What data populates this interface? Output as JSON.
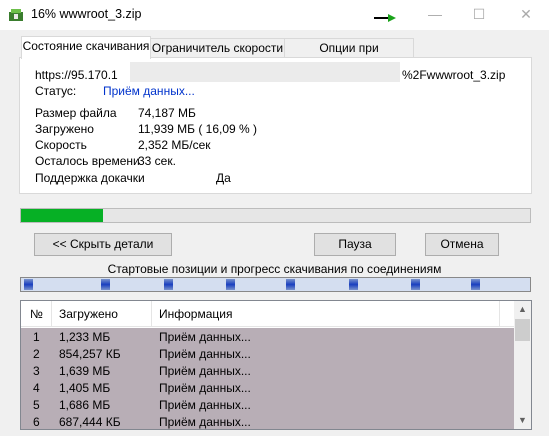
{
  "window": {
    "title": "16% wwwroot_3.zip",
    "minimize": "—",
    "maximize": "☐",
    "close": "✕"
  },
  "tabs": [
    "Состояние скачивания",
    "Ограничитель скорости",
    "Опции при завершении"
  ],
  "download": {
    "url_start": "https://95.170.1",
    "url_end": "%2Fwwwroot_3.zip",
    "status_label": "Статус:",
    "status_value": "Приём данных...",
    "file_size_label": "Размер файла",
    "file_size_value": "74,187  МБ",
    "downloaded_label": "Загружено",
    "downloaded_value": "11,939  МБ  ( 16,09 % )",
    "speed_label": "Скорость",
    "speed_value": "2,352  МБ/сек",
    "remaining_label": "Осталось времени",
    "remaining_value": "33 сек.",
    "resume_label": "Поддержка докачки",
    "resume_value": "Да",
    "progress_fraction": 0.1609
  },
  "buttons": {
    "hide_details": "<< Скрыть детали",
    "pause": "Пауза",
    "cancel": "Отмена"
  },
  "connections_caption": "Стартовые позиции и прогресс скачивания по соединениям",
  "table": {
    "columns": [
      "№",
      "Загружено",
      "Информация"
    ],
    "rows": [
      [
        "1",
        "1,233  МБ",
        "Приём данных..."
      ],
      [
        "2",
        "854,257  КБ",
        "Приём данных..."
      ],
      [
        "3",
        "1,639  МБ",
        "Приём данных..."
      ],
      [
        "4",
        "1,405  МБ",
        "Приём данных..."
      ],
      [
        "5",
        "1,686  МБ",
        "Приём данных..."
      ],
      [
        "6",
        "687,444  КБ",
        "Приём данных..."
      ]
    ]
  },
  "colors": {
    "progress": "#06b025",
    "row_bg": "#b8aeb6",
    "status_text": "#0033cc"
  }
}
